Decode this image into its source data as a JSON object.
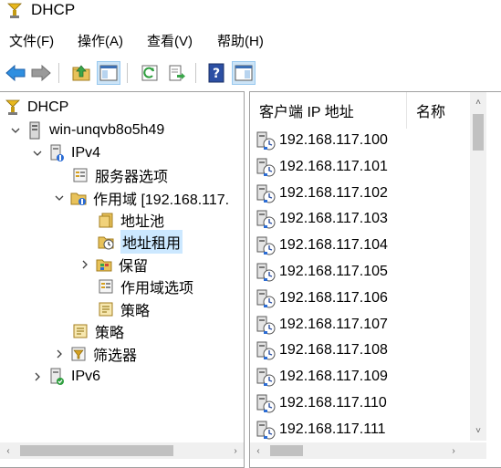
{
  "window": {
    "title": "DHCP"
  },
  "menu": [
    {
      "label": "文件(F)"
    },
    {
      "label": "操作(A)"
    },
    {
      "label": "查看(V)"
    },
    {
      "label": "帮助(H)"
    }
  ],
  "toolbar": {
    "buttons": [
      {
        "icon": "back-arrow-icon"
      },
      {
        "icon": "forward-arrow-icon"
      },
      {
        "icon": "up-folder-icon"
      },
      {
        "icon": "show-hide-console-tree-icon"
      },
      {
        "icon": "refresh-icon"
      },
      {
        "icon": "export-list-icon"
      },
      {
        "icon": "help-icon"
      },
      {
        "icon": "show-hide-action-pane-icon"
      }
    ]
  },
  "tree": {
    "items": [
      {
        "label": "DHCP",
        "icon": "dhcp-root-icon"
      },
      {
        "label": "win-unqvb8o5h49",
        "icon": "server-icon"
      },
      {
        "label": "IPv4",
        "icon": "ipv4-icon"
      },
      {
        "label": "服务器选项",
        "icon": "server-options-icon"
      },
      {
        "label": "作用域 [192.168.117.",
        "icon": "scope-folder-icon"
      },
      {
        "label": "地址池",
        "icon": "address-pool-icon"
      },
      {
        "label": "地址租用",
        "icon": "address-leases-icon"
      },
      {
        "label": "保留",
        "icon": "reservations-icon"
      },
      {
        "label": "作用域选项",
        "icon": "scope-options-icon"
      },
      {
        "label": "策略",
        "icon": "policies-icon"
      },
      {
        "label": "策略",
        "icon": "policies-icon"
      },
      {
        "label": "筛选器",
        "icon": "filters-icon"
      },
      {
        "label": "IPv6",
        "icon": "ipv6-icon"
      }
    ]
  },
  "list": {
    "columns": [
      {
        "label": "客户端 IP 地址"
      },
      {
        "label": "名称"
      }
    ],
    "rows": [
      {
        "ip": "192.168.117.100"
      },
      {
        "ip": "192.168.117.101"
      },
      {
        "ip": "192.168.117.102"
      },
      {
        "ip": "192.168.117.103"
      },
      {
        "ip": "192.168.117.104"
      },
      {
        "ip": "192.168.117.105"
      },
      {
        "ip": "192.168.117.106"
      },
      {
        "ip": "192.168.117.107"
      },
      {
        "ip": "192.168.117.108"
      },
      {
        "ip": "192.168.117.109"
      },
      {
        "ip": "192.168.117.110"
      },
      {
        "ip": "192.168.117.111"
      }
    ]
  },
  "colors": {
    "selection": "#cce8ff",
    "toolbar_pressed": "#cce4f7",
    "scrollbar_thumb": "#c1c1c1",
    "pane_border": "#a0a0a0"
  }
}
